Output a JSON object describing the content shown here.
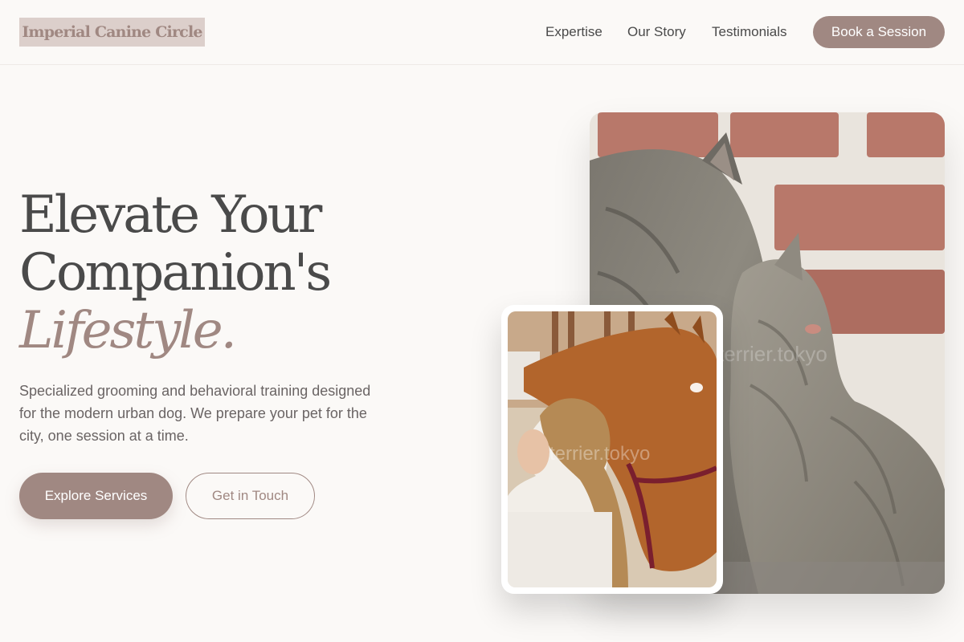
{
  "header": {
    "logo": "Imperial Canine Circle",
    "nav": {
      "expertise": "Expertise",
      "story": "Our Story",
      "testimonials": "Testimonials"
    },
    "cta": "Book a Session"
  },
  "hero": {
    "title_line1": "Elevate Your",
    "title_line2": "Companion's",
    "title_accent": "Lifestyle.",
    "description": "Specialized grooming and behavioral training designed for the modern urban dog. We prepare your pet for the city, one session at a time.",
    "primary_cta": "Explore Services",
    "secondary_cta": "Get in Touch"
  },
  "images": {
    "watermark": "terrier.tokyo"
  },
  "colors": {
    "accent": "#a08882",
    "text": "#4a4a4a",
    "background": "#fbf9f7"
  }
}
